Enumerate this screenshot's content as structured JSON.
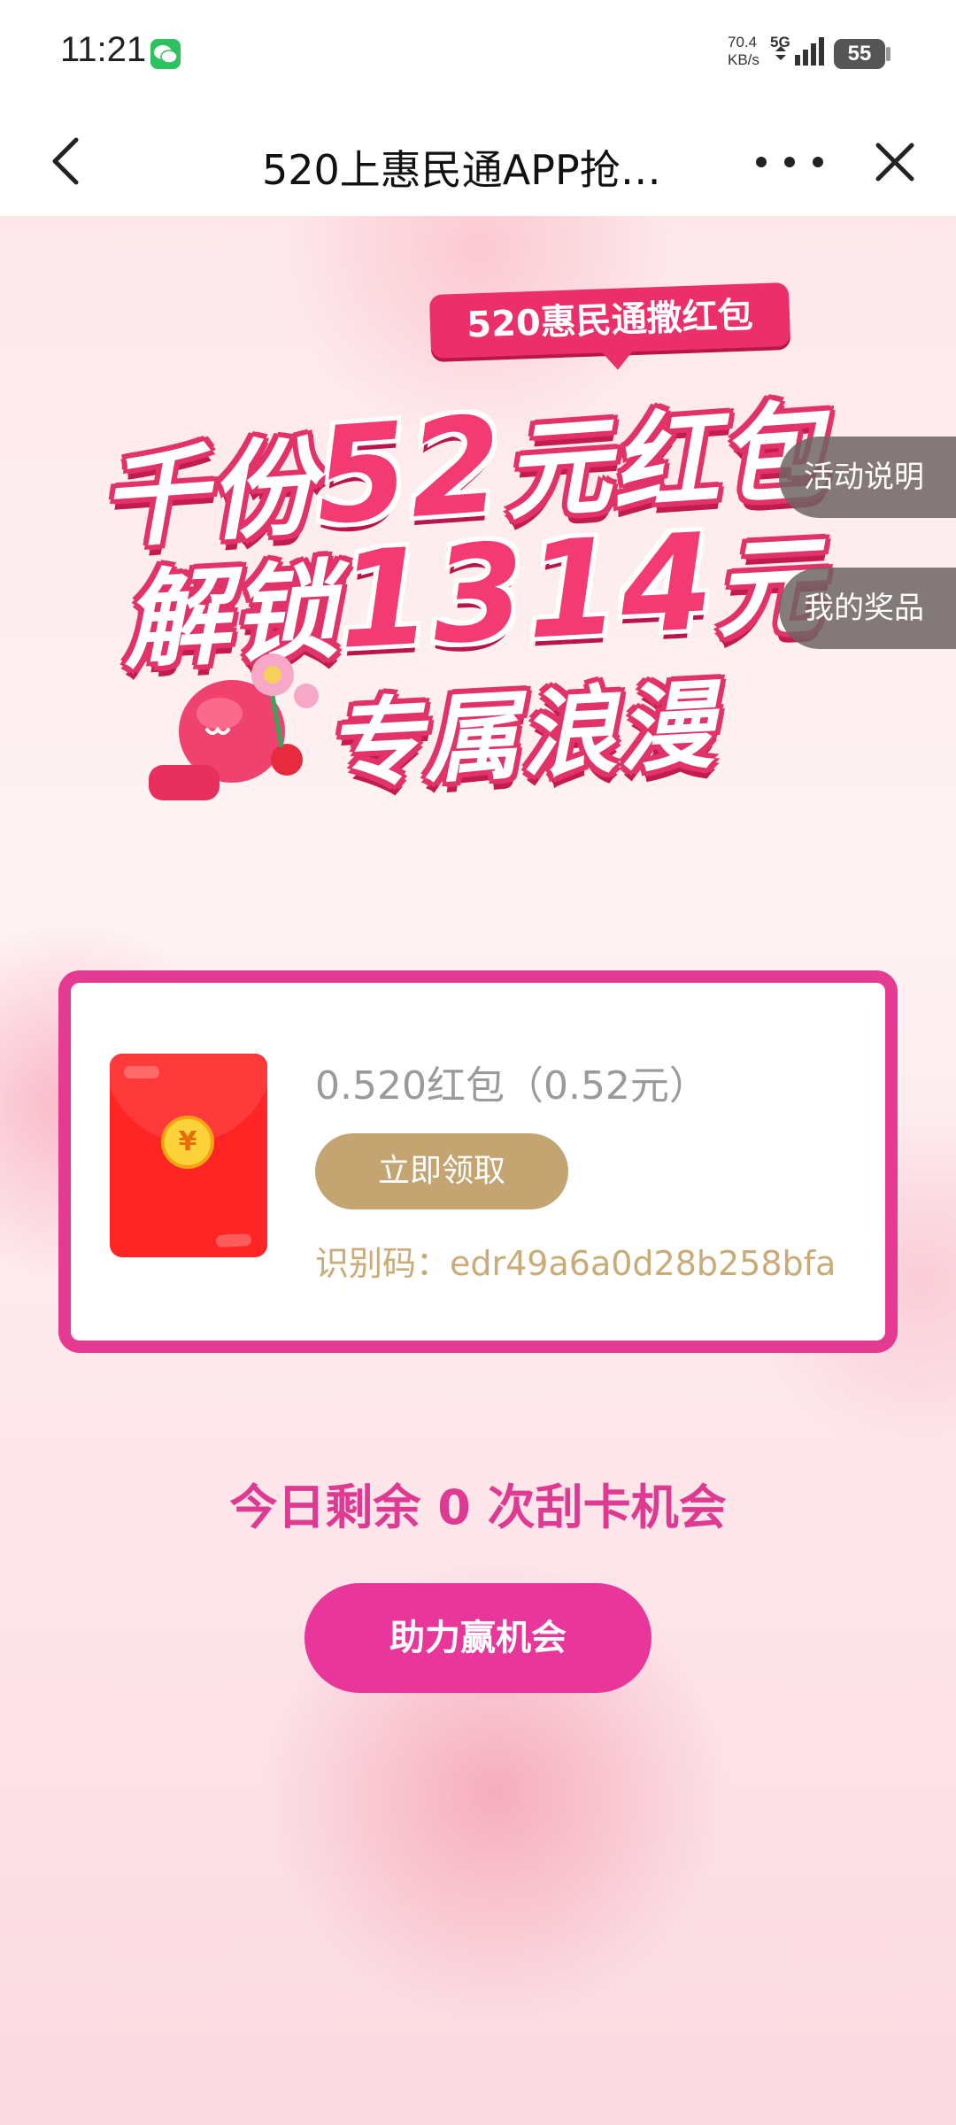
{
  "status_bar": {
    "time": "11:21",
    "speed_value": "70.4",
    "speed_unit": "KB/s",
    "network": "5G",
    "battery": "55",
    "icons": [
      "wechat-icon",
      "signal-icon",
      "battery-icon"
    ]
  },
  "nav": {
    "title": "520上惠民通APP抢…",
    "icons": [
      "back-icon",
      "more-icon",
      "close-icon"
    ]
  },
  "banner": {
    "tag": "520惠民通撒红包",
    "line1_a": "千份",
    "line1_big": "52",
    "line1_b": "元红包",
    "line2_a": "解锁",
    "line2_big": "1314",
    "line2_b": "元",
    "line3": "专属浪漫"
  },
  "side_tabs": {
    "rules": "活动说明",
    "prizes": "我的奖品"
  },
  "prize_card": {
    "name": "0.520红包（0.52元）",
    "claim_label": "立即领取",
    "code": "识别码：edr49a6a0d28b258bfa",
    "coin_symbol": "¥"
  },
  "remaining_text": "今日剩余 0 次刮卡机会",
  "boost_label": "助力赢机会",
  "colors": {
    "accent": "#e8369a",
    "claim_button": "#c4a572",
    "card_border": "#e53a92"
  }
}
